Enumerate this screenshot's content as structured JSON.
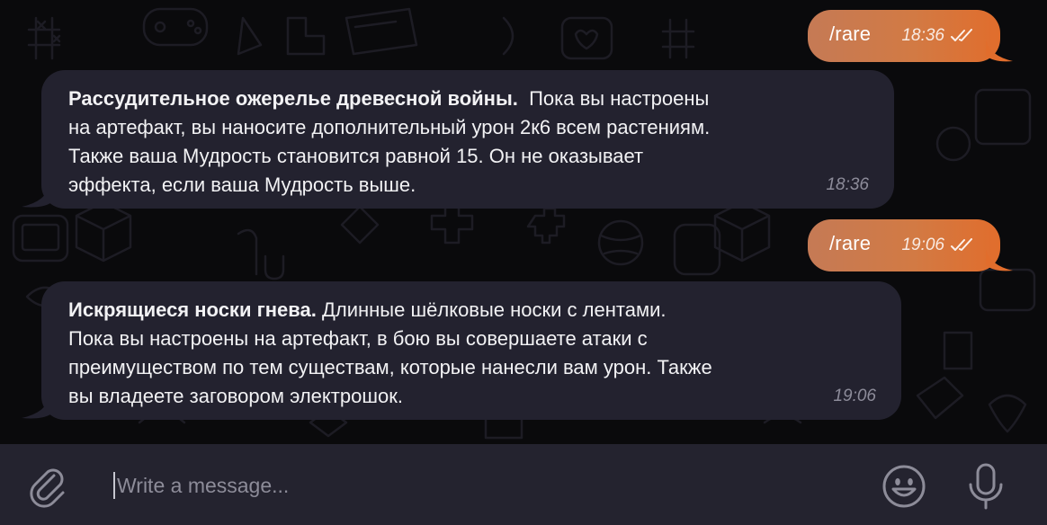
{
  "messages": [
    {
      "type": "outgoing",
      "text": "/rare",
      "time": "18:36"
    },
    {
      "type": "incoming",
      "title": "Рассудительное ожерелье древесной войны.",
      "lines": [
        "Пока вы настроены",
        "на артефакт, вы наносите дополнительный урон 2к6 всем растениям.",
        "Также ваша Мудрость становится равной 15. Он не оказывает",
        "эффекта, если ваша Мудрость выше."
      ],
      "time": "18:36"
    },
    {
      "type": "outgoing",
      "text": "/rare",
      "time": "19:06"
    },
    {
      "type": "incoming",
      "title": "Искрящиеся носки гнева.",
      "lines": [
        "Длинные шёлковые носки с лентами.",
        "Пока вы настроены на артефакт, в бою вы совершаете атаки с",
        "преимуществом по тем существам, которые нанесли вам урон. Также",
        "вы владеете заговором электрошок."
      ],
      "time": "19:06"
    }
  ],
  "composer": {
    "placeholder": "Write a message...",
    "attach_icon": "paperclip-icon",
    "emoji_icon": "smiley-icon",
    "mic_icon": "microphone-icon"
  },
  "colors": {
    "outgoing_start": "#c57a55",
    "outgoing_end": "#e16d2c",
    "incoming_bg": "#23222f",
    "composer_bg": "#24232f",
    "chat_bg": "#0a0a0c"
  }
}
